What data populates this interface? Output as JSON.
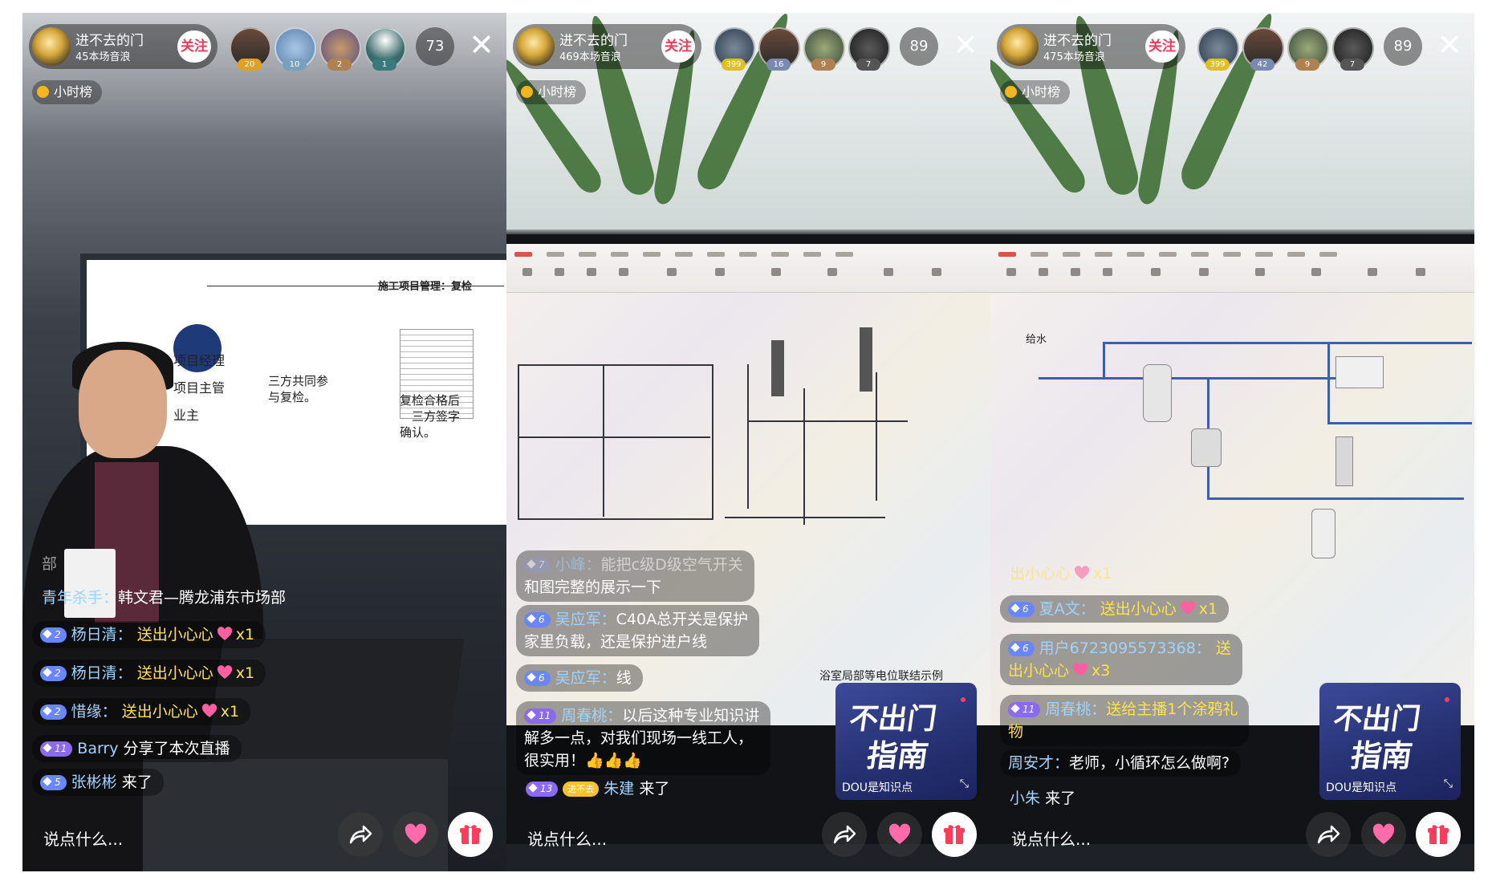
{
  "colors": {
    "follow_text": "#f03a5a",
    "level_badge": "#6a86ff",
    "name_text": "#9fd3ff",
    "highlight_text": "#ffe24a",
    "promo_bg": "#253070"
  },
  "common": {
    "follow_label": "关注",
    "hourly_rank_label": "小时榜",
    "say_placeholder": "说点什么...",
    "promo_title_1": "不出门",
    "promo_title_2": "指南",
    "promo_subtitle": "DOU是知识点",
    "close_icon": "close-icon",
    "share_icon": "share-icon",
    "like_icon": "heart-icon",
    "gift_icon": "gift-icon"
  },
  "panels": [
    {
      "host": {
        "name": "进不去的门",
        "sub": "45本场音浪"
      },
      "viewers": [
        {
          "badge": "20"
        },
        {
          "badge": "10"
        },
        {
          "badge": "2"
        },
        {
          "badge": "1"
        }
      ],
      "viewer_count": "73",
      "slide": {
        "title": "施工项目管理：复检",
        "lines": [
          "项目经理",
          "项目主管",
          "业主",
          "三方共同参",
          "与复检。",
          "复检合格后",
          "三方签字",
          "确认。"
        ]
      },
      "messages": [
        {
          "type": "plain",
          "faded_text": "部",
          "sender": "青年杀手：",
          "text": "韩文君—腾龙浦东市场部"
        },
        {
          "level": "2",
          "sender": "杨日清：",
          "action": "送出小心心",
          "qty": "x1"
        },
        {
          "level": "2",
          "sender": "杨日清：",
          "action": "送出小心心",
          "qty": "x1"
        },
        {
          "level": "2",
          "sender": "惜缘：",
          "action": "送出小心心",
          "qty": "x1"
        },
        {
          "level": "11",
          "sender": "Barry",
          "text": "分享了本次直播"
        },
        {
          "level": "5",
          "sender": "张彬彬",
          "text": "来了"
        }
      ]
    },
    {
      "host": {
        "name": "进不去的门",
        "sub": "469本场音浪"
      },
      "viewers": [
        {
          "badge": "399"
        },
        {
          "badge": "16"
        },
        {
          "badge": "9"
        },
        {
          "badge": "7"
        }
      ],
      "viewer_count": "89",
      "plan_caption": "浴室局部等电位联结示例",
      "messages": [
        {
          "level": "7",
          "sender": "小峰：",
          "text": "能把c级D级空气开关",
          "text2": "和图完整的展示一下"
        },
        {
          "level": "6",
          "sender": "吴应军：",
          "text": "C40A总开关是保护",
          "text2": "家里负载，还是保护进户线"
        },
        {
          "level": "6",
          "sender": "吴应军：",
          "text": "线"
        },
        {
          "level": "11",
          "sender": "周春桃：",
          "text": "以后这种专业知识讲",
          "text2": "解多一点，对我们现场一线工人，",
          "text3": "很实用！👍👍👍"
        },
        {
          "level": "13",
          "tag": "进不去",
          "sender": "朱建",
          "text": "来了"
        }
      ]
    },
    {
      "host": {
        "name": "进不去的门",
        "sub": "475本场音浪"
      },
      "viewers": [
        {
          "badge": "399"
        },
        {
          "badge": "42"
        },
        {
          "badge": "9"
        },
        {
          "badge": "7"
        }
      ],
      "viewer_count": "89",
      "plan_caption": "给水",
      "messages": [
        {
          "faded": "出小心心",
          "qty": "x1"
        },
        {
          "level": "6",
          "sender": "夏A文：",
          "action": "送出小心心",
          "qty": "x1"
        },
        {
          "level": "6",
          "sender": "用户6723095573368：",
          "action": "送",
          "action2": "出小心心",
          "qty": "x3"
        },
        {
          "level": "11",
          "sender": "周春桃：",
          "action": "送给主播1个涂鸦礼",
          "action2": "物"
        },
        {
          "type": "plain",
          "sender": "周安才：",
          "text": "老师，小循环怎么做啊?"
        },
        {
          "type": "plain",
          "sender": "小朱",
          "text": "来了"
        }
      ]
    }
  ]
}
